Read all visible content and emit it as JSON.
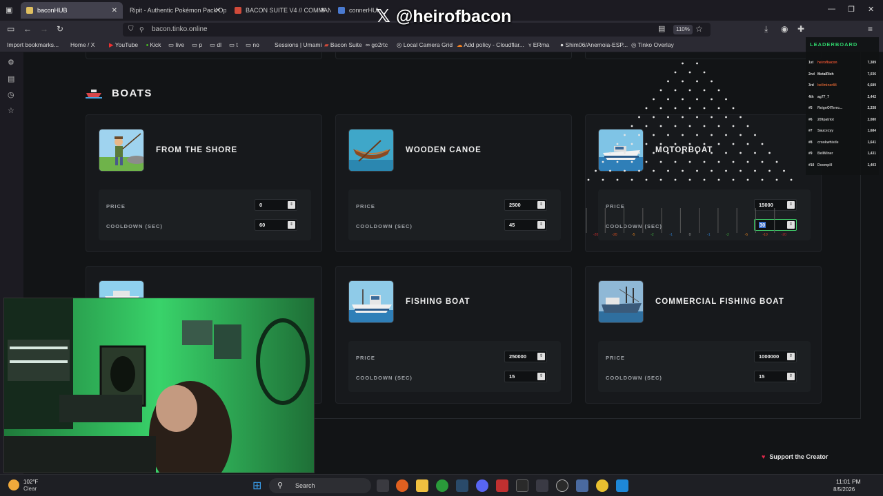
{
  "browser": {
    "tabs": [
      {
        "label": "baconHUB",
        "color": "#e0c060"
      },
      {
        "label": "Ripit - Authentic Pokémon Pack Op",
        "color": "#3a3a3a"
      },
      {
        "label": "BACON SUITE V4 // COMMAND",
        "color": "#d04a3a"
      },
      {
        "label": "connerHUB",
        "color": "#4a7ad0"
      }
    ],
    "url": "bacon.tinko.online",
    "zoom": "110%",
    "bookmarks": [
      "Import bookmarks...",
      "Home / X",
      "YouTube",
      "Kick",
      "live",
      "p",
      "dl",
      "t",
      "no",
      "Sessions | Umami",
      "Bacon Suite",
      "go2rtc",
      "Local Camera Grid",
      "Add policy - Cloudflar...",
      "ERma",
      "Shim06/Anemoia-ESP...",
      "Tinko Overlay"
    ]
  },
  "overlay": {
    "handle": "@heirofbacon",
    "leaderboard_title": "LEADERBOARD",
    "leaderboard": [
      {
        "rank": "1st",
        "name": "heirofbacon",
        "score": "7,389",
        "color": "#e05030"
      },
      {
        "rank": "2nd",
        "name": "MetalRich",
        "score": "7,036",
        "color": "#e0e0e0"
      },
      {
        "rank": "3rd",
        "name": "bellminer84",
        "score": "6,689",
        "color": "#d06030"
      },
      {
        "rank": "4th",
        "name": "ag77_7",
        "score": "2,442",
        "color": "#d0d0d0"
      },
      {
        "rank": "#5",
        "name": "ReignOfTerro...",
        "score": "2,338",
        "color": "#c0c0c0"
      },
      {
        "rank": "#6",
        "name": "209patriot",
        "score": "2,080",
        "color": "#c0c0c0"
      },
      {
        "rank": "#7",
        "name": "Saucecyy",
        "score": "1,684",
        "color": "#c0c0c0"
      },
      {
        "rank": "#8",
        "name": "crookwhistle",
        "score": "1,641",
        "color": "#c0c0c0"
      },
      {
        "rank": "#9",
        "name": "BellMiner",
        "score": "1,431",
        "color": "#c0c0c0"
      },
      {
        "rank": "#10",
        "name": "Doompill",
        "score": "1,403",
        "color": "#c0c0c0"
      }
    ],
    "plinko_slots": [
      "-20",
      "-20",
      "-5",
      "-2",
      "-1",
      "0",
      "-1",
      "-2",
      "-5",
      "-10",
      "-20"
    ]
  },
  "page": {
    "section_title": "BOATS",
    "price_label": "PRICE",
    "cooldown_label": "COOLDOWN (SEC)",
    "cards": [
      {
        "name": "FROM THE SHORE",
        "price": "0",
        "cooldown": "60"
      },
      {
        "name": "WOODEN CANOE",
        "price": "2500",
        "cooldown": "45"
      },
      {
        "name": "MOTORBOAT",
        "price": "15000",
        "cooldown": "30"
      },
      {
        "name": "",
        "price": "",
        "cooldown": ""
      },
      {
        "name": "FISHING BOAT",
        "price": "250000",
        "cooldown": "15"
      },
      {
        "name": "COMMERCIAL FISHING BOAT",
        "price": "1000000",
        "cooldown": "15"
      }
    ],
    "support_label": "Support the Creator"
  },
  "taskbar": {
    "temp": "102°F",
    "weather": "Clear",
    "search": "Search",
    "time": "11:01 PM",
    "date": "8/5/2026"
  },
  "colors": {
    "accent_green": "#2fd26b",
    "heart": "#e0294b"
  }
}
